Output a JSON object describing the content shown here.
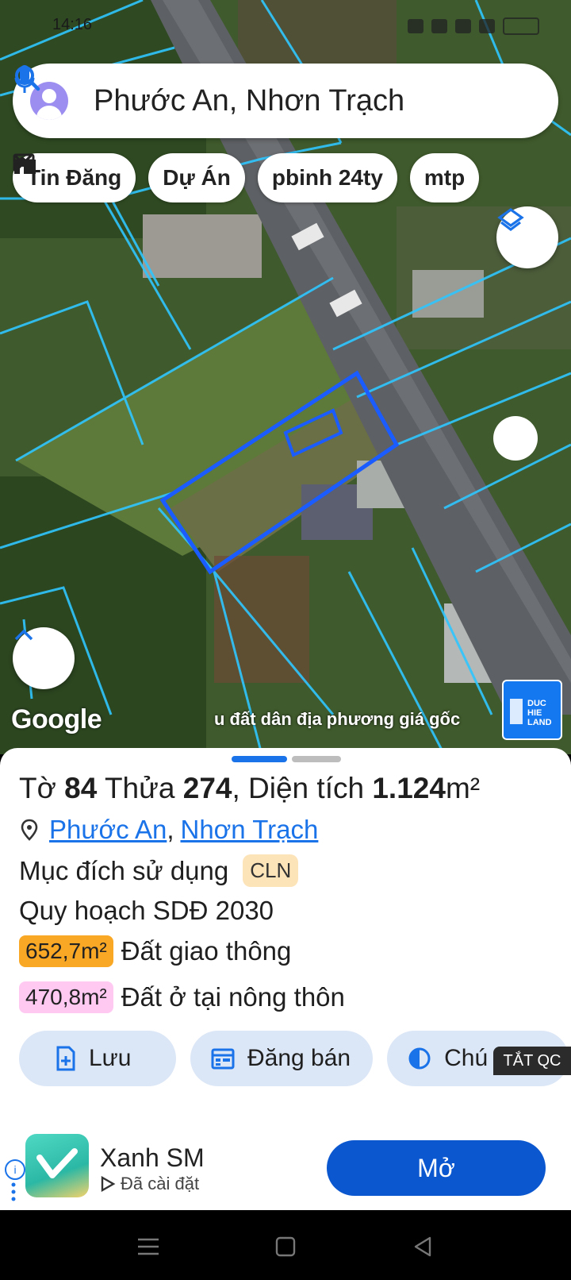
{
  "status": {
    "time": "14:16"
  },
  "search": {
    "query": "Phước An, Nhơn Trạch"
  },
  "chips": [
    {
      "label": "Tin Đăng",
      "icon": "list-card-icon"
    },
    {
      "label": "Dự Án",
      "icon": "buildings-icon"
    },
    {
      "label": "pbinh 24ty",
      "icon": "pattern-icon"
    },
    {
      "label": "mtp",
      "icon": "pattern-icon"
    }
  ],
  "map": {
    "attribution": "Google",
    "watermark": "u đất dân địa phương giá gốc",
    "logo_text": "DUC HIE LAND",
    "parcel_color": "#1a5cff",
    "boundary_color": "#2fc6ff"
  },
  "parcel": {
    "sheet_label": "Tờ",
    "sheet_no": "84",
    "lot_label": "Thửa",
    "lot_no": "274",
    "area_label": ", Diện tích",
    "area_value": "1.124",
    "area_unit": "m²",
    "ward": "Phước An",
    "district": "Nhơn Trạch",
    "separator": ",",
    "purpose_label": "Mục đích sử dụng",
    "purpose_code": "CLN",
    "plan_label": "Quy hoạch SDĐ 2030",
    "zones": [
      {
        "value": "652,7m²",
        "label": "Đất giao thông",
        "color": "#f9a825"
      },
      {
        "value": "470,8m²",
        "label": "Đất ở tại nông thôn",
        "color": "#ffc9f2"
      }
    ]
  },
  "actions": [
    {
      "label": "Lưu",
      "icon": "save-doc-icon"
    },
    {
      "label": "Đăng bán",
      "icon": "calendar-icon"
    },
    {
      "label": "Chú thích",
      "icon": "contrast-icon"
    }
  ],
  "ad": {
    "close_label": "TẮT QC",
    "app_name": "Xanh SM",
    "installed": "Đã cài đặt",
    "open_label": "Mở",
    "info": "i"
  },
  "colors": {
    "accent": "#1a73e8",
    "button_bg": "#dbe6f6",
    "badge_bg": "#fde3b8",
    "ad_button": "#0b57d0"
  }
}
